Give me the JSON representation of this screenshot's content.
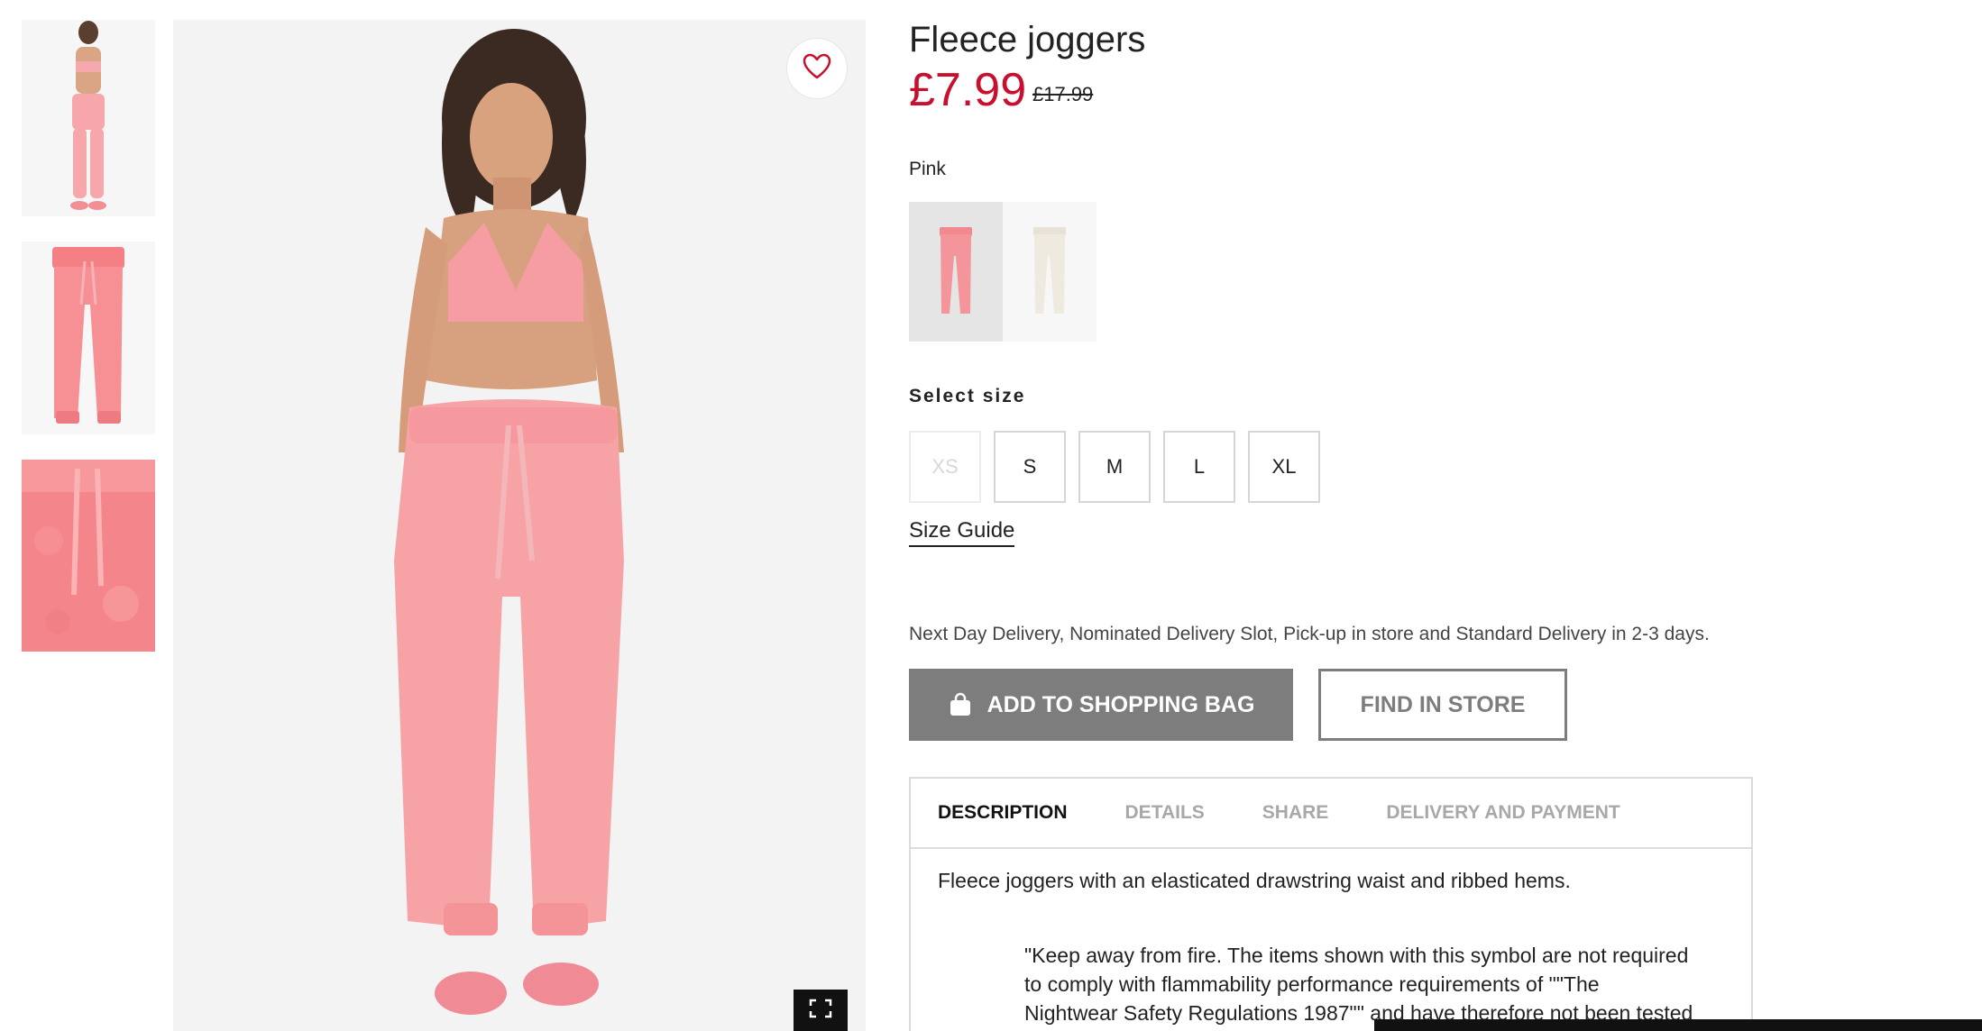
{
  "gallery": {
    "thumbnails": [
      {
        "name": "model-front-view"
      },
      {
        "name": "product-flat-view"
      },
      {
        "name": "fabric-detail-view"
      }
    ],
    "colors": {
      "pink": "#f59a9a",
      "background": "#f3f3f3",
      "accent": "#c8102e"
    }
  },
  "product": {
    "title": "Fleece joggers",
    "price": "£7.99",
    "old_price": "£17.99",
    "color_name": "Pink",
    "swatches": [
      {
        "name": "Pink",
        "selected": true,
        "hex": "#f59a9a"
      },
      {
        "name": "Cream",
        "selected": false,
        "hex": "#efeae0"
      }
    ]
  },
  "sizes": {
    "label": "Select size",
    "options": [
      {
        "label": "XS",
        "available": false
      },
      {
        "label": "S",
        "available": true
      },
      {
        "label": "M",
        "available": true
      },
      {
        "label": "L",
        "available": true
      },
      {
        "label": "XL",
        "available": true
      }
    ],
    "guide_label": "Size Guide"
  },
  "delivery_text": "Next Day Delivery, Nominated Delivery Slot, Pick-up in store and Standard Delivery in 2-3 days.",
  "actions": {
    "add_to_bag": "ADD TO SHOPPING BAG",
    "find_in_store": "FIND IN STORE"
  },
  "tabs": [
    {
      "label": "DESCRIPTION",
      "active": true
    },
    {
      "label": "DETAILS",
      "active": false
    },
    {
      "label": "SHARE",
      "active": false
    },
    {
      "label": "DELIVERY AND PAYMENT",
      "active": false
    }
  ],
  "description": {
    "summary": "Fleece joggers with an elasticated drawstring waist and ribbed hems.",
    "care_line1": "\"Keep away from fire. The items shown with this symbol are not required",
    "care_line2": "to comply with flammability performance requirements of \"\"The",
    "care_line3": "Nightwear Safety Regulations 1987\"\" and have therefore not been tested"
  },
  "icons": {
    "favorite": "heart-icon",
    "fullscreen": "fullscreen-icon",
    "bag": "shopping-bag-icon"
  }
}
